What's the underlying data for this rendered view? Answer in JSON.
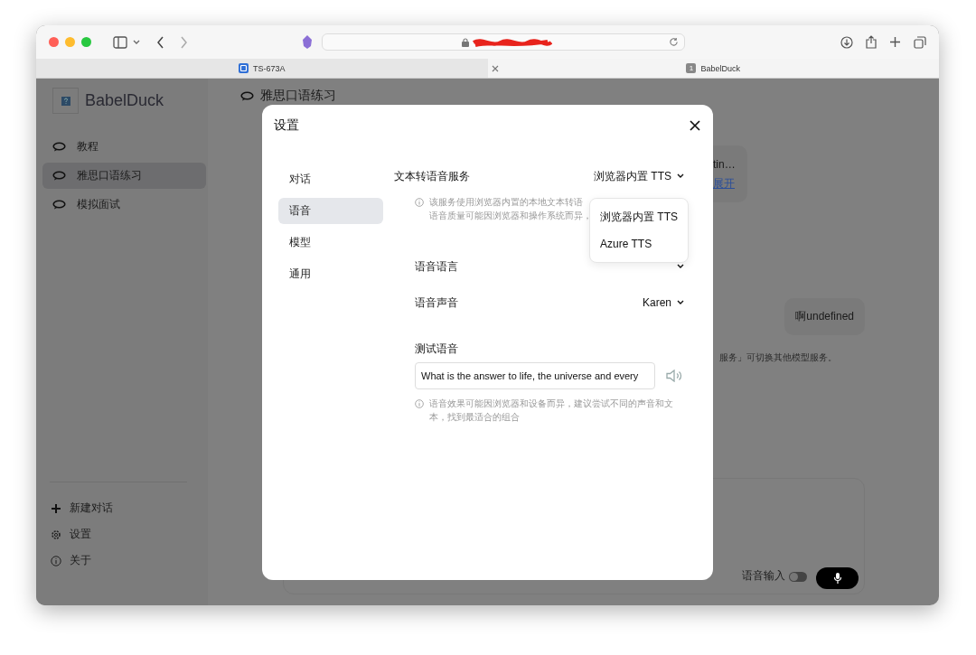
{
  "browser": {
    "tabs": [
      {
        "label": "TS-673A",
        "selected": false
      },
      {
        "label": "BabelDuck",
        "badge": "1",
        "selected": true
      }
    ]
  },
  "sidebar": {
    "app_name": "BabelDuck",
    "conversations": [
      {
        "label": "教程",
        "selected": false
      },
      {
        "label": "雅思口语练习",
        "selected": true
      },
      {
        "label": "模拟面试",
        "selected": false
      }
    ],
    "actions": [
      {
        "label": "新建对话",
        "kind": "new"
      },
      {
        "label": "设置",
        "kind": "settings"
      },
      {
        "label": "关于",
        "kind": "about"
      }
    ]
  },
  "main": {
    "title": "雅思口语练习",
    "messages": [
      {
        "text": "tin…",
        "link": "展开"
      },
      {
        "text": "啊undefined"
      }
    ],
    "hint": "服务」可切换其他模型服务。",
    "voice_input": {
      "label": "语音输入",
      "on": false
    }
  },
  "settings_dialog": {
    "title": "设置",
    "nav": [
      {
        "label": "对话",
        "selected": false
      },
      {
        "label": "语音",
        "selected": true
      },
      {
        "label": "模型",
        "selected": false
      },
      {
        "label": "通用",
        "selected": false
      }
    ],
    "tts_service": {
      "label": "文本转语音服务",
      "value": "浏览器内置 TTS"
    },
    "service_menu": {
      "options": [
        "浏览器内置 TTS",
        "Azure TTS"
      ]
    },
    "service_info": [
      "该服务使用浏览器内置的本地文本转语",
      "语音质量可能因浏览器和操作系统而异，"
    ],
    "language": {
      "label": "语音语言"
    },
    "voice": {
      "label": "语音声音",
      "value": "Karen"
    },
    "test": {
      "label": "测试语音",
      "value": "What is the answer to life, the universe and every"
    },
    "test_info": "语音效果可能因浏览器和设备而异，建议尝试不同的声音和文本，找到最适合的组合"
  }
}
